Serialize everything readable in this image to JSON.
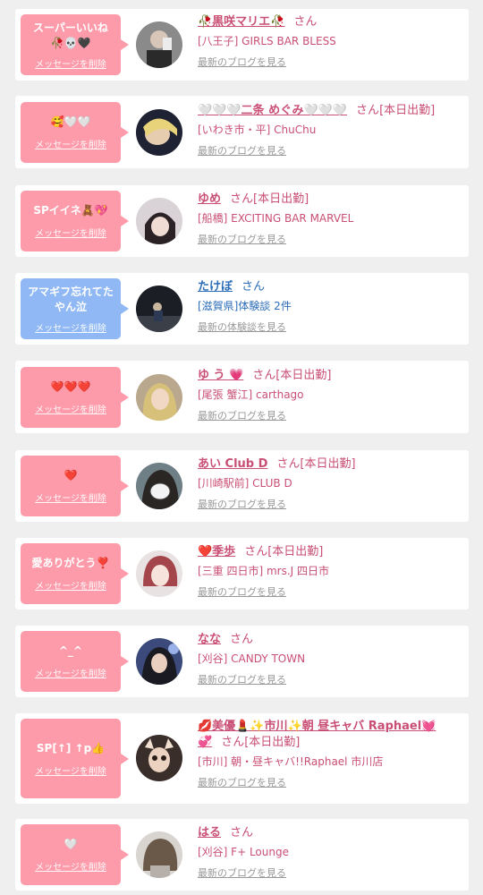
{
  "items": [
    {
      "message_line1": "スーパーいいね",
      "message_line2": "🥀💀🖤",
      "delete_label": "メッセージを削除",
      "name": "🥀黒咲マリエ🥀",
      "san": "さん",
      "status": "",
      "shop": "[八王子] GIRLS BAR BLESS",
      "blog": "最新のブログを見る",
      "bubble_color": "pink"
    },
    {
      "message_line1": "🥰🤍🤍",
      "message_line2": "",
      "delete_label": "メッセージを削除",
      "name": "🤍🤍🤍二条 めぐみ🤍🤍🤍",
      "san": "さん",
      "status": "[本日出勤]",
      "shop": "[いわき市・平] ChuChu",
      "blog": "最新のブログを見る",
      "bubble_color": "pink"
    },
    {
      "message_line1": "SPイイネ🧸💖",
      "message_line2": "",
      "delete_label": "メッセージを削除",
      "name": "ゆめ",
      "san": "さん",
      "status": "[本日出勤]",
      "shop": "[船橋] EXCITING BAR MARVEL",
      "blog": "最新のブログを見る",
      "bubble_color": "pink"
    },
    {
      "message_line1": "アマギフ忘れてた",
      "message_line2": "やん泣",
      "delete_label": "メッセージを削除",
      "name": "たけぼ",
      "san": "さん",
      "status": "",
      "shop": "[滋賀県]体験談 2件",
      "blog": "最新の体験談を見る",
      "bubble_color": "blue"
    },
    {
      "message_line1": "❤️❤️❤️",
      "message_line2": "",
      "delete_label": "メッセージを削除",
      "name": "ゆ う 💗",
      "san": "さん",
      "status": "[本日出勤]",
      "shop": "[尾張 蟹江] carthago",
      "blog": "最新のブログを見る",
      "bubble_color": "pink"
    },
    {
      "message_line1": "❤️",
      "message_line2": "",
      "delete_label": "メッセージを削除",
      "name": "あい Club D",
      "san": "さん",
      "status": "[本日出勤]",
      "shop": "[川崎駅前] CLUB D",
      "blog": "最新のブログを見る",
      "bubble_color": "pink"
    },
    {
      "message_line1": "愛ありがとう❣️",
      "message_line2": "",
      "delete_label": "メッセージを削除",
      "name": "❤️季歩",
      "san": "さん",
      "status": "[本日出勤]",
      "shop": "[三重 四日市] mrs.J 四日市",
      "blog": "最新のブログを見る",
      "bubble_color": "pink"
    },
    {
      "message_line1": "^_^",
      "message_line2": "",
      "delete_label": "メッセージを削除",
      "name": "なな",
      "san": "さん",
      "status": "",
      "shop": "[刈谷] CANDY TOWN",
      "blog": "最新のブログを見る",
      "bubble_color": "pink"
    },
    {
      "message_line1": "SP[↑] ↑p👍",
      "message_line2": "",
      "delete_label": "メッセージを削除",
      "name": "💋美優💄✨市川✨朝 昼キャバ Raphael💓",
      "name_cont": "💞",
      "san": "さん",
      "status": "[本日出勤]",
      "shop": "[市川] 朝・昼キャバ!!Raphael 市川店",
      "blog": "最新のブログを見る",
      "bubble_color": "pink"
    },
    {
      "message_line1": "🤍",
      "message_line2": "",
      "delete_label": "メッセージを削除",
      "name": "はる",
      "san": "さん",
      "status": "",
      "shop": "[刈谷] F+ Lounge",
      "blog": "最新のブログを見る",
      "bubble_color": "pink"
    }
  ]
}
